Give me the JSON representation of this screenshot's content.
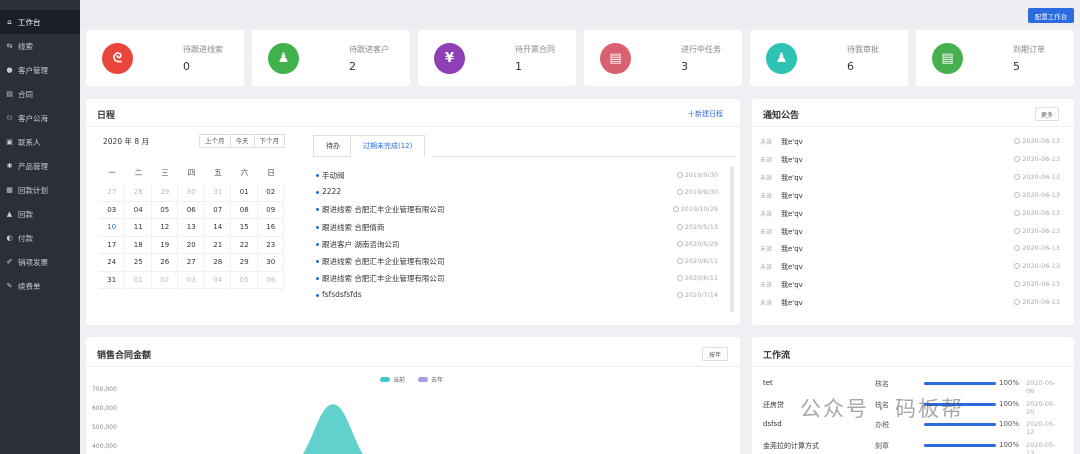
{
  "sidebar": {
    "items": [
      {
        "label": "工作台",
        "icon": "home-icon",
        "glyph": "⌂",
        "active": true
      },
      {
        "label": "线索",
        "icon": "link-icon",
        "glyph": "⇆"
      },
      {
        "label": "客户管理",
        "icon": "user-icon",
        "glyph": "●"
      },
      {
        "label": "合同",
        "icon": "document-icon",
        "glyph": "▤"
      },
      {
        "label": "客户公海",
        "icon": "users-icon",
        "glyph": "⚇"
      },
      {
        "label": "联系人",
        "icon": "contact-card-icon",
        "glyph": "▣"
      },
      {
        "label": "产品管理",
        "icon": "gear-icon",
        "glyph": "✱"
      },
      {
        "label": "回款计划",
        "icon": "calendar-icon",
        "glyph": "▦"
      },
      {
        "label": "回款",
        "icon": "coins-icon",
        "glyph": "▲"
      },
      {
        "label": "付款",
        "icon": "payment-icon",
        "glyph": "◐"
      },
      {
        "label": "销项发票",
        "icon": "invoice-icon",
        "glyph": "✐"
      },
      {
        "label": "续费单",
        "icon": "renew-icon",
        "glyph": "✎"
      }
    ]
  },
  "topbar": {
    "config_label": "配置工作台"
  },
  "stats": [
    {
      "label": "待跟进线索",
      "value": "0",
      "color": "#e8463b",
      "glyph": "ᘓ",
      "icon": "clue-icon"
    },
    {
      "label": "待跟进客户",
      "value": "2",
      "color": "#3fb24c",
      "glyph": "♟",
      "icon": "customer-icon"
    },
    {
      "label": "待开票合同",
      "value": "1",
      "color": "#8e3fb4",
      "glyph": "¥",
      "icon": "yen-icon"
    },
    {
      "label": "进行中任务",
      "value": "3",
      "color": "#d9606e",
      "glyph": "▤",
      "icon": "task-icon"
    },
    {
      "label": "待我审批",
      "value": "6",
      "color": "#2dc4b6",
      "glyph": "♟",
      "icon": "approval-icon"
    },
    {
      "label": "到期订单",
      "value": "5",
      "color": "#46b050",
      "glyph": "▤",
      "icon": "order-icon"
    }
  ],
  "schedule": {
    "title": "日程",
    "new_label": "十新建日程",
    "month_label": "2020 年 8 月",
    "nav": {
      "prev": "上个月",
      "today": "今天",
      "next": "下个月"
    },
    "weekdays": [
      "一",
      "二",
      "三",
      "四",
      "五",
      "六",
      "日"
    ],
    "weeks": [
      [
        {
          "d": "27",
          "m": true
        },
        {
          "d": "28",
          "m": true
        },
        {
          "d": "29",
          "m": true
        },
        {
          "d": "30",
          "m": true
        },
        {
          "d": "31",
          "m": true
        },
        {
          "d": "01"
        },
        {
          "d": "02"
        }
      ],
      [
        {
          "d": "03"
        },
        {
          "d": "04"
        },
        {
          "d": "05"
        },
        {
          "d": "06"
        },
        {
          "d": "07"
        },
        {
          "d": "08"
        },
        {
          "d": "09"
        }
      ],
      [
        {
          "d": "10",
          "t": true
        },
        {
          "d": "11"
        },
        {
          "d": "12"
        },
        {
          "d": "13"
        },
        {
          "d": "14"
        },
        {
          "d": "15"
        },
        {
          "d": "16"
        }
      ],
      [
        {
          "d": "17"
        },
        {
          "d": "18"
        },
        {
          "d": "19"
        },
        {
          "d": "20"
        },
        {
          "d": "21"
        },
        {
          "d": "22"
        },
        {
          "d": "23"
        }
      ],
      [
        {
          "d": "24"
        },
        {
          "d": "25"
        },
        {
          "d": "26"
        },
        {
          "d": "27"
        },
        {
          "d": "28"
        },
        {
          "d": "29"
        },
        {
          "d": "30"
        }
      ],
      [
        {
          "d": "31"
        },
        {
          "d": "01",
          "m": true
        },
        {
          "d": "02",
          "m": true
        },
        {
          "d": "03",
          "m": true
        },
        {
          "d": "04",
          "m": true
        },
        {
          "d": "05",
          "m": true
        },
        {
          "d": "06",
          "m": true
        }
      ]
    ],
    "tabs": [
      "待办",
      "过期未完成(12)"
    ],
    "tasks": [
      {
        "text": "手动阀",
        "date": "2019/9/30"
      },
      {
        "text": "2222",
        "date": "2019/9/30"
      },
      {
        "text": "跟进线索 合肥汇丰企业管理有限公司",
        "date": "2019/10/29"
      },
      {
        "text": "跟进线索 合肥倩商",
        "date": "2020/5/13"
      },
      {
        "text": "跟进客户 湖南咨询公司",
        "date": "2020/5/29"
      },
      {
        "text": "跟进线索 合肥汇丰企业管理有限公司",
        "date": "2020/6/11"
      },
      {
        "text": "跟进线索 合肥汇丰企业管理有限公司",
        "date": "2020/6/11"
      },
      {
        "text": "fsfsdsfsfds",
        "date": "2020/7/14"
      }
    ]
  },
  "notices": {
    "title": "通知公告",
    "more_label": "更多",
    "items": [
      {
        "status": "未读",
        "text": "我e'qv",
        "date": "2020-06-13"
      },
      {
        "status": "未读",
        "text": "我e'qv",
        "date": "2020-06-13"
      },
      {
        "status": "未读",
        "text": "我e'qv",
        "date": "2020-06-13"
      },
      {
        "status": "未读",
        "text": "我e'qv",
        "date": "2020-06-13"
      },
      {
        "status": "未读",
        "text": "我e'qv",
        "date": "2020-06-13"
      },
      {
        "status": "未读",
        "text": "我e'qv",
        "date": "2020-06-13"
      },
      {
        "status": "未读",
        "text": "我e'qv",
        "date": "2020-06-13"
      },
      {
        "status": "未读",
        "text": "我e'qv",
        "date": "2020-06-13"
      },
      {
        "status": "未读",
        "text": "我e'qv",
        "date": "2020-06-13"
      },
      {
        "status": "未读",
        "text": "我e'qv",
        "date": "2020-06-13"
      }
    ]
  },
  "sales": {
    "title": "销售合同金额",
    "toggle_label": "按年",
    "chart_data": {
      "type": "area",
      "series": [
        {
          "name": "当前",
          "color": "#45c9c6"
        },
        {
          "name": "去年",
          "color": "#a89be0"
        }
      ],
      "yticks": [
        "700,000",
        "600,000",
        "500,000",
        "400,000"
      ],
      "ylim": [
        350000,
        700000
      ],
      "peak_value": 620000
    }
  },
  "workflow": {
    "title": "工作流",
    "items": [
      {
        "name": "tet",
        "step": "核名",
        "progress": 100,
        "pct": "100%",
        "date": "2020-06-06"
      },
      {
        "name": "还房贷",
        "step": "核名",
        "progress": 100,
        "pct": "100%",
        "date": "2020-05-20"
      },
      {
        "name": "dsfsd",
        "step": "办税",
        "progress": 100,
        "pct": "100%",
        "date": "2020-05-12"
      },
      {
        "name": "金莞拉的计算方式",
        "step": "刻章",
        "progress": 100,
        "pct": "100%",
        "date": "2020-05-13"
      }
    ]
  },
  "watermark": "公众号 · 码板帮"
}
